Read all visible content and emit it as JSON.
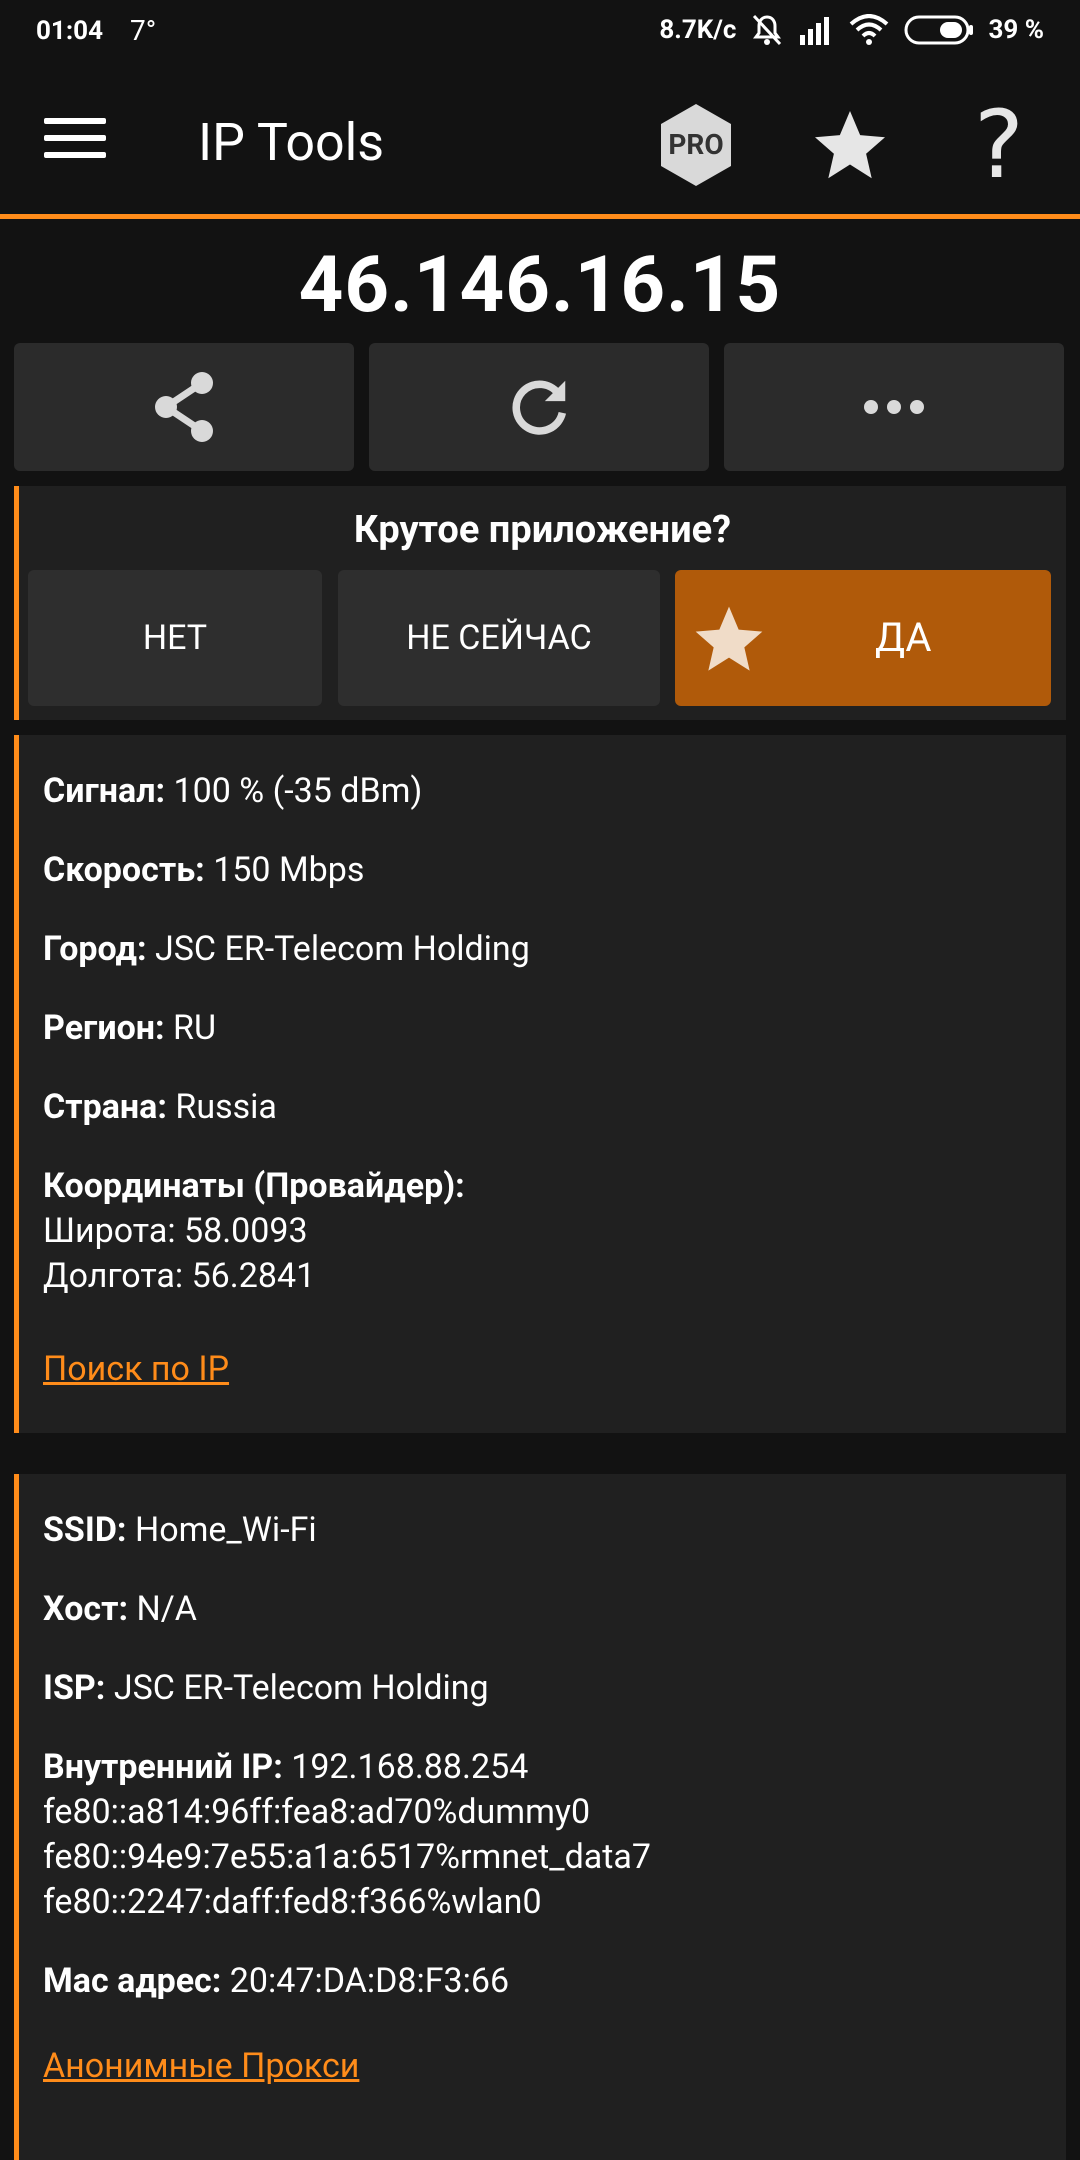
{
  "status": {
    "time": "01:04",
    "temp": "7°",
    "net_speed": "8.7K/c",
    "battery": "39 %"
  },
  "appbar": {
    "title": "IP Tools",
    "pro_label": "PRO",
    "help_label": "?"
  },
  "ip": "46.146.16.15",
  "rate": {
    "question": "Крутое приложение?",
    "no": "НЕТ",
    "later": "НЕ СЕЙЧАС",
    "yes": "ДА"
  },
  "card1": {
    "signal_label": "Сигнал:",
    "signal_value": "100 % (-35 dBm)",
    "speed_label": "Скорость:",
    "speed_value": "150 Mbps",
    "city_label": "Город:",
    "city_value": "JSC ER-Telecom Holding",
    "region_label": "Регион:",
    "region_value": "RU",
    "country_label": "Страна:",
    "country_value": "Russia",
    "coords_label": "Координаты (Провайдер):",
    "lat": "Широта: 58.0093",
    "lon": "Долгота: 56.2841",
    "link": "Поиск по IP"
  },
  "card2": {
    "ssid_label": "SSID:",
    "ssid_value": "Home_Wi-Fi",
    "host_label": "Хост:",
    "host_value": "N/A",
    "isp_label": "ISP:",
    "isp_value": "JSC ER-Telecom Holding",
    "internal_label": "Внутренний IP:",
    "internal_value": "192.168.88.254",
    "ipv6_1": "fe80::a814:96ff:fea8:ad70%dummy0",
    "ipv6_2": "fe80::94e9:7e55:a1a:6517%rmnet_data7",
    "ipv6_3": "fe80::2247:daff:fed8:f366%wlan0",
    "mac_label": "Mac адрес:",
    "mac_value": "20:47:DA:D8:F3:66",
    "link": "Анонимные Прокси"
  }
}
